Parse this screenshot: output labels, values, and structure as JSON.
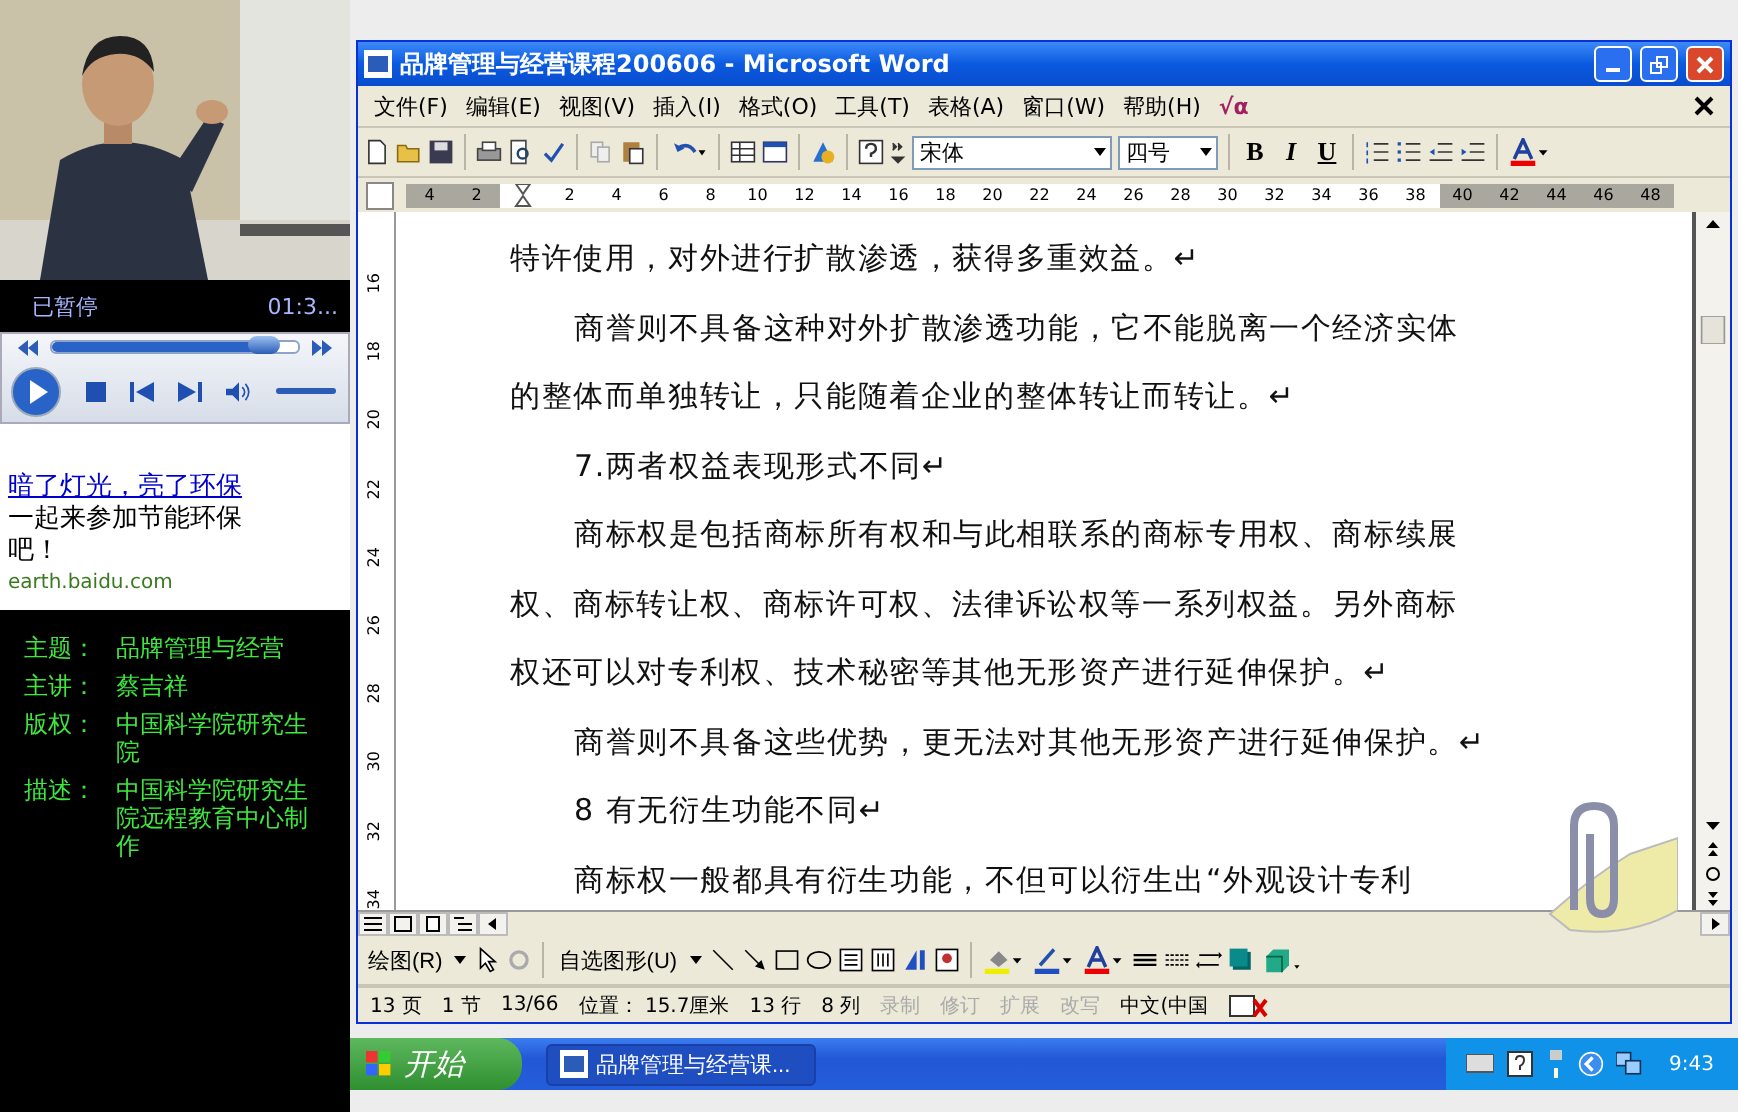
{
  "player": {
    "status": "已暂停",
    "time": "01:3...",
    "seek": {
      "level": 0.86
    },
    "volume": {
      "level": 1
    }
  },
  "ad": {
    "link": "暗了灯光，亮了环保",
    "text": "一起来参加节能环保吧！",
    "url": "earth.baidu.com"
  },
  "info": [
    {
      "label": "主题：",
      "value": "品牌管理与经营"
    },
    {
      "label": "主讲：",
      "value": "蔡吉祥"
    },
    {
      "label": "版权：",
      "value": "中国科学院研究生院"
    },
    {
      "label": "描述：",
      "value": "中国科学院研究生院远程教育中心制作"
    }
  ],
  "word": {
    "title": "品牌管理与经营课程200606 - Microsoft Word",
    "menu": [
      "文件(F)",
      "编辑(E)",
      "视图(V)",
      "插入(I)",
      "格式(O)",
      "工具(T)",
      "表格(A)",
      "窗口(W)",
      "帮助(H)"
    ],
    "equation_button": "√α",
    "toolbar": {
      "font": "宋体",
      "size": "四号",
      "format_buttons": [
        {
          "label": "B",
          "kind": "bold"
        },
        {
          "label": "I",
          "kind": "italic"
        },
        {
          "label": "U",
          "kind": "underline"
        }
      ]
    },
    "ruler": [
      {
        "text": "4",
        "margin": true
      },
      {
        "text": "2",
        "margin": true
      },
      {
        "text": "2",
        "margin": false
      },
      {
        "text": "4",
        "margin": false
      },
      {
        "text": "6",
        "margin": false
      },
      {
        "text": "8",
        "margin": false
      },
      {
        "text": "10",
        "margin": false
      },
      {
        "text": "12",
        "margin": false
      },
      {
        "text": "14",
        "margin": false
      },
      {
        "text": "16",
        "margin": false
      },
      {
        "text": "18",
        "margin": false
      },
      {
        "text": "20",
        "margin": false
      },
      {
        "text": "22",
        "margin": false
      },
      {
        "text": "24",
        "margin": false
      },
      {
        "text": "26",
        "margin": false
      },
      {
        "text": "28",
        "margin": false
      },
      {
        "text": "30",
        "margin": false
      },
      {
        "text": "32",
        "margin": false
      },
      {
        "text": "34",
        "margin": false
      },
      {
        "text": "36",
        "margin": false
      },
      {
        "text": "38",
        "margin": false
      },
      {
        "text": "40",
        "margin": true
      },
      {
        "text": "42",
        "margin": true
      },
      {
        "text": "44",
        "margin": true
      },
      {
        "text": "46",
        "margin": true
      },
      {
        "text": "48",
        "margin": true
      }
    ],
    "vertical_ruler": [
      "16",
      "18",
      "20",
      "22",
      "24",
      "26",
      "28",
      "30",
      "32",
      "34"
    ],
    "document": [
      {
        "text": "特许使用，对外进行扩散渗透，获得多重效益。↵",
        "kind": "continuation"
      },
      {
        "text": "商誉则不具备这种对外扩散渗透功能，它不能脱离一个经济实体",
        "kind": "start"
      },
      {
        "text": "的整体而单独转让，只能随着企业的整体转让而转让。↵",
        "kind": "continuation"
      },
      {
        "text": "7.两者权益表现形式不同↵",
        "kind": "start"
      },
      {
        "text": "商标权是包括商标所有权和与此相联系的商标专用权、商标续展",
        "kind": "start"
      },
      {
        "text": "权、商标转让权、商标许可权、法律诉讼权等一系列权益。另外商标",
        "kind": "continuation"
      },
      {
        "text": "权还可以对专利权、技术秘密等其他无形资产进行延伸保护。↵",
        "kind": "continuation"
      },
      {
        "text": "商誉则不具备这些优势，更无法对其他无形资产进行延伸保护。↵",
        "kind": "start"
      },
      {
        "text": "8 有无衍生功能不同↵",
        "kind": "start"
      },
      {
        "text": "商标权一般都具有衍生功能，不但可以衍生出“外观设计专利",
        "kind": "start"
      }
    ],
    "drawing_toolbar": [
      "绘图(R)",
      "自选图形(U)"
    ],
    "status_bar": [
      {
        "text": "13 页",
        "disabled": false
      },
      {
        "text": "1 节",
        "disabled": false
      },
      {
        "text": "13/66",
        "disabled": false
      },
      {
        "text": "位置： 15.7厘米",
        "disabled": false
      },
      {
        "text": "13 行",
        "disabled": false
      },
      {
        "text": "8 列",
        "disabled": false
      },
      {
        "text": "录制",
        "disabled": true
      },
      {
        "text": "修订",
        "disabled": true
      },
      {
        "text": "扩展",
        "disabled": true
      },
      {
        "text": "改写",
        "disabled": true
      },
      {
        "text": "中文(中国",
        "disabled": false
      }
    ]
  },
  "taskbar": {
    "start": "开始",
    "task": "品牌管理与经营课...",
    "clock": "9:43"
  }
}
